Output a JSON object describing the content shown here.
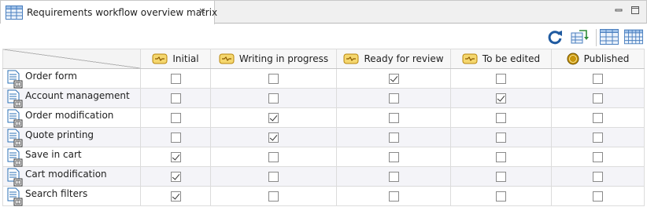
{
  "window": {
    "tab_title": "Requirements workflow overview matrix",
    "tab_icon": "matrix-icon",
    "close_glyph": "✕"
  },
  "toolbar": {
    "buttons": [
      "refresh-icon",
      "transpose-icon",
      "table-view-icon",
      "column-view-icon"
    ]
  },
  "matrix": {
    "columns": [
      {
        "label": "Initial",
        "icon": "workflow-state-icon"
      },
      {
        "label": "Writing in progress",
        "icon": "workflow-state-icon"
      },
      {
        "label": "Ready for review",
        "icon": "workflow-state-icon"
      },
      {
        "label": "To be edited",
        "icon": "workflow-state-icon"
      },
      {
        "label": "Published",
        "icon": "final-state-icon"
      }
    ],
    "rows": [
      {
        "label": "Order form",
        "checks": [
          false,
          false,
          true,
          false,
          false
        ]
      },
      {
        "label": "Account management",
        "checks": [
          false,
          false,
          false,
          true,
          false
        ]
      },
      {
        "label": "Order modification",
        "checks": [
          false,
          true,
          false,
          false,
          false
        ]
      },
      {
        "label": "Quote printing",
        "checks": [
          false,
          true,
          false,
          false,
          false
        ]
      },
      {
        "label": "Save in cart",
        "checks": [
          true,
          false,
          false,
          false,
          false
        ]
      },
      {
        "label": "Cart modification",
        "checks": [
          true,
          false,
          false,
          false,
          false
        ]
      },
      {
        "label": "Search filters",
        "checks": [
          true,
          false,
          false,
          false,
          false
        ]
      }
    ]
  },
  "colors": {
    "state_icon_fill": "#f5d76e",
    "state_icon_stroke": "#b8860b",
    "published_fill": "#c8960c",
    "req_icon_blue": "#2a6fb5"
  }
}
